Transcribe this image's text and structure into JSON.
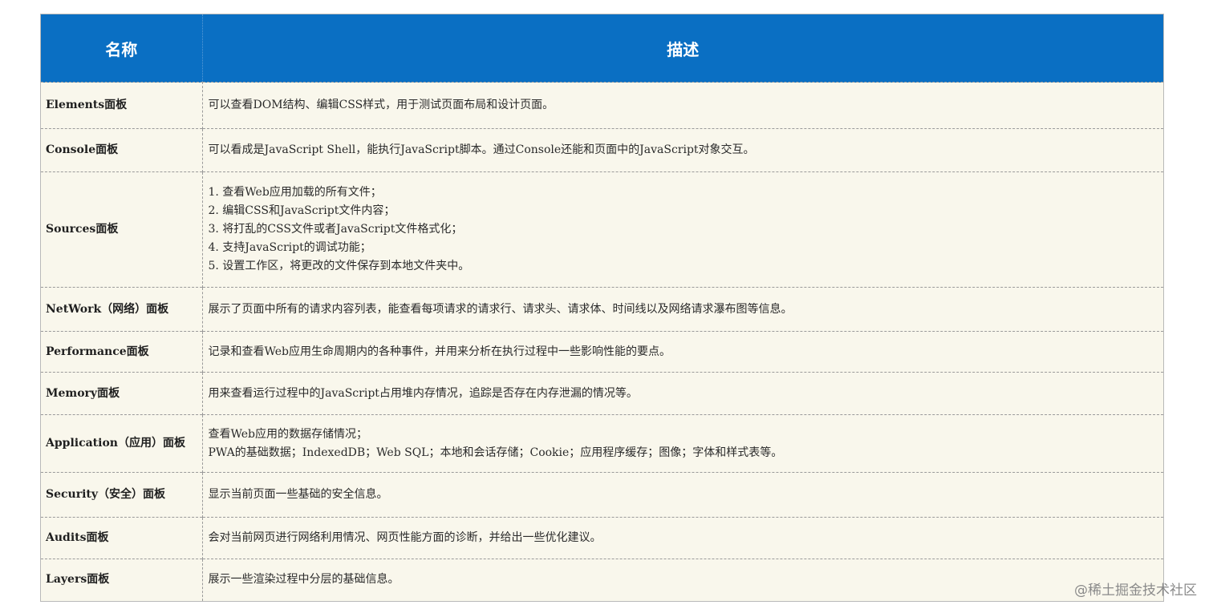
{
  "table": {
    "headers": {
      "name": "名称",
      "desc": "描述"
    },
    "rows": [
      {
        "name": "Elements面板",
        "desc": [
          "可以查看DOM结构、编辑CSS样式，用于测试页面布局和设计页面。"
        ]
      },
      {
        "name": "Console面板",
        "desc": [
          "可以看成是JavaScript Shell，能执行JavaScript脚本。通过Console还能和页面中的JavaScript对象交互。"
        ]
      },
      {
        "name": "Sources面板",
        "desc": [
          "1. 查看Web应用加载的所有文件；",
          "2. 编辑CSS和JavaScript文件内容；",
          "3. 将打乱的CSS文件或者JavaScript文件格式化；",
          "4. 支持JavaScript的调试功能；",
          "5. 设置工作区，将更改的文件保存到本地文件夹中。"
        ]
      },
      {
        "name": "NetWork（网络）面板",
        "desc": [
          "展示了页面中所有的请求内容列表，能查看每项请求的请求行、请求头、请求体、时间线以及网络请求瀑布图等信息。"
        ]
      },
      {
        "name": "Performance面板",
        "desc": [
          "记录和查看Web应用生命周期内的各种事件，并用来分析在执行过程中一些影响性能的要点。"
        ]
      },
      {
        "name": "Memory面板",
        "desc": [
          "用来查看运行过程中的JavaScript占用堆内存情况，追踪是否存在内存泄漏的情况等。"
        ]
      },
      {
        "name": "Application（应用）面板",
        "desc": [
          "查看Web应用的数据存储情况；",
          "PWA的基础数据；IndexedDB；Web SQL；本地和会话存储；Cookie；应用程序缓存；图像；字体和样式表等。"
        ]
      },
      {
        "name": "Security（安全）面板",
        "desc": [
          "显示当前页面一些基础的安全信息。"
        ]
      },
      {
        "name": "Audits面板",
        "desc": [
          "会对当前网页进行网络利用情况、网页性能方面的诊断，并给出一些优化建议。"
        ]
      },
      {
        "name": "Layers面板",
        "desc": [
          "展示一些渲染过程中分层的基础信息。"
        ]
      }
    ]
  },
  "watermark": "@稀土掘金技术社区"
}
